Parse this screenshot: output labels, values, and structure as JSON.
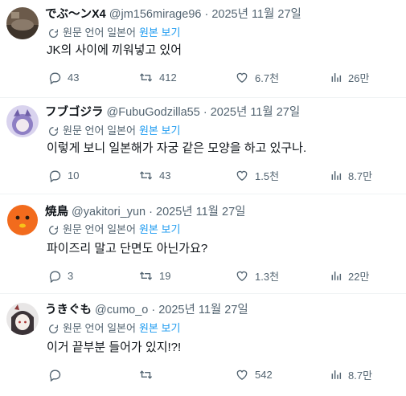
{
  "translate_label": "원문 언어 일본어",
  "show_original_label": "원본 보기",
  "tweets": [
    {
      "name": "でぶ〜ンX4",
      "meta": "@jm156mirage96 · 2025년 11월 27일",
      "text": "JK의 사이에 끼워넣고 있어",
      "replies": "43",
      "retweets": "412",
      "likes": "6.7천",
      "views": "26만"
    },
    {
      "name": "フブゴジラ",
      "meta": "@FubuGodzilla55 · 2025년 11월 27일",
      "text": "이렇게 보니 일본해가 자궁 같은 모양을 하고 있구나.",
      "replies": "10",
      "retweets": "43",
      "likes": "1.5천",
      "views": "8.7만"
    },
    {
      "name": "焼鳥",
      "meta": "@yakitori_yun · 2025년 11월 27일",
      "text": "파이즈리 말고 단면도 아닌가요?",
      "replies": "3",
      "retweets": "19",
      "likes": "1.3천",
      "views": "22만"
    },
    {
      "name": "うきぐも",
      "meta": "@cumo_o · 2025년 11월 27일",
      "text": "이거 끝부분 들어가 있지!?!",
      "replies": "",
      "retweets": "",
      "likes": "542",
      "views": "8.7만"
    }
  ]
}
